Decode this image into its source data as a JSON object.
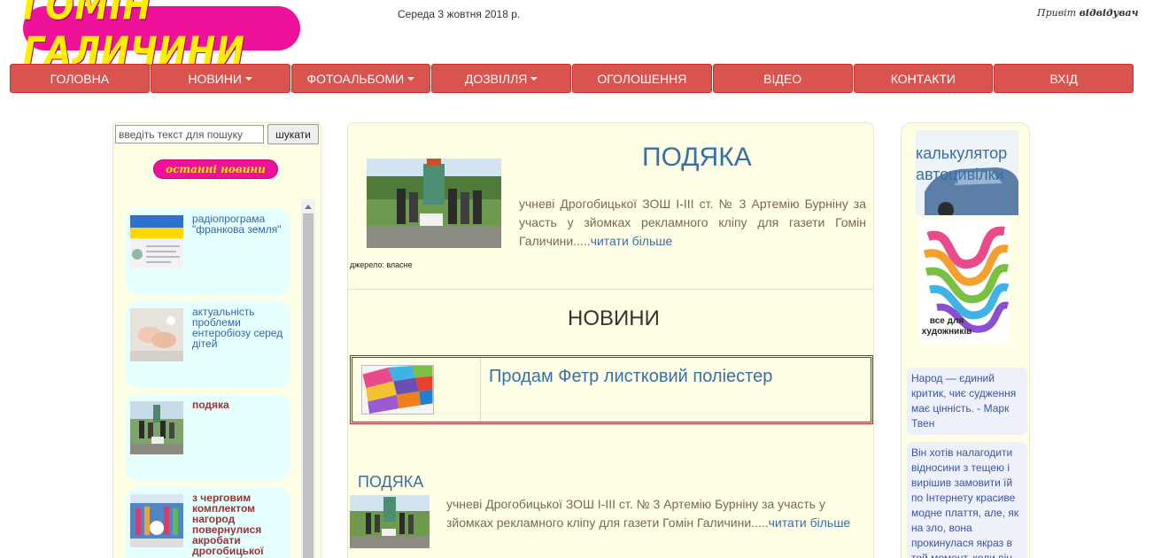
{
  "header": {
    "logo_text": "ГОМІН ГАЛИЧИНИ",
    "date": "Середа 3 жовтня 2018 р.",
    "greeting_prefix": "Привіт",
    "greeting_name": "відвідувач"
  },
  "nav": {
    "items": [
      {
        "label": "ГОЛОВНА",
        "dropdown": false
      },
      {
        "label": "НОВИНИ",
        "dropdown": true
      },
      {
        "label": "ФОТОАЛЬБОМИ",
        "dropdown": true
      },
      {
        "label": "ДОЗВІЛЛЯ",
        "dropdown": true
      },
      {
        "label": "ОГОЛОШЕННЯ",
        "dropdown": false
      },
      {
        "label": "ВІДЕО",
        "dropdown": false
      },
      {
        "label": "КОНТАКТИ",
        "dropdown": false
      },
      {
        "label": "ВХІД",
        "dropdown": false
      }
    ]
  },
  "sidebar": {
    "search_placeholder": "введіть текст для пошуку",
    "search_button": "шукати",
    "latest_label": "останні новини",
    "news": [
      {
        "title": "радіопрограма \"франкова земля\"",
        "style": "blue"
      },
      {
        "title": "актуальність проблеми ентеробіозу серед дітей",
        "style": "blue"
      },
      {
        "title": "подяка",
        "style": "red"
      },
      {
        "title": "з черговим комплектом нагород повернулися акробати дрогобицької дюсш ім і боберського",
        "style": "red"
      }
    ]
  },
  "featured": {
    "title": "ПОДЯКА",
    "text": "учневі Дрогобицької ЗОШ І-ІІІ ст. № 3 Артемію Бурніну за участь у зйомках рекламного кліпу для газети Гомін Галичини.....",
    "read_more": "читати більше",
    "source": "джерело: власне"
  },
  "news_section": {
    "title": "НОВИНИ",
    "ad_title": "Продам Фетр листковий поліестер"
  },
  "article": {
    "title": "ПОДЯКА",
    "text": "учневі Дрогобицької ЗОШ І-ІІІ ст. № 3 Артемію Бурніну за участь у зйомках рекламного кліпу для газети Гомін Галичини.....",
    "read_more": "читати більше"
  },
  "right": {
    "calc_label": "калькулятор автоцивілки",
    "art_label": "все для художників",
    "quotes": [
      "Народ — єдиний критик, чиє судження має цінність. - Марк Твен",
      "Він хотів налагодити відносини з тещею і вирішив замовити їй по Інтернету красиве модне плаття, але, як на зло, вона прокинулася якраз в той момент, коли він"
    ]
  },
  "colors": {
    "nav_red": "#d9534f",
    "logo_pink": "#ee1199",
    "logo_yellow": "#ffee00",
    "panel_bg": "#ffffe6",
    "link_blue": "#3a6fa6"
  }
}
